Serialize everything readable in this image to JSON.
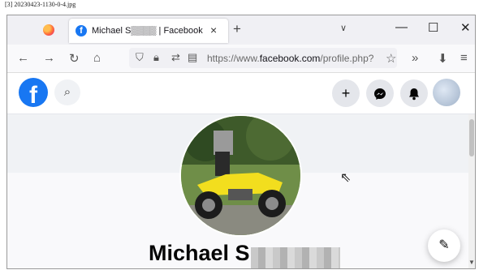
{
  "caption": "[3] 20230423-1130-0-4.jpg",
  "tab": {
    "title": "Michael S▒▒▒▒ | Facebook",
    "close": "×"
  },
  "tabbar": {
    "new_tab": "+",
    "list_tabs": "∨",
    "minimize": "—",
    "maximize": "☐",
    "close": "✕"
  },
  "toolbar": {
    "back": "←",
    "forward": "→",
    "reload": "↻",
    "home": "⌂",
    "url_prefix": "https://www.",
    "url_domain": "facebook.com",
    "url_rest": "/profile.php?",
    "star": "☆",
    "more": "»",
    "extensions": "⬇",
    "menu": "≡"
  },
  "facebook": {
    "logo": "f",
    "search": "🔍",
    "create": "+",
    "messenger": "✉",
    "notifications": "🔔"
  },
  "profile": {
    "name": "Michael S",
    "edit": "✎"
  },
  "icons": [
    "firefox-icon",
    "facebook-favicon",
    "shield-icon",
    "lock-icon",
    "permissions-icon",
    "reader-icon",
    "search-icon",
    "messenger-icon",
    "bell-icon",
    "edit-icon"
  ],
  "colors": {
    "facebook_blue": "#1877f2",
    "cover_grey": "#f0f2f5"
  }
}
